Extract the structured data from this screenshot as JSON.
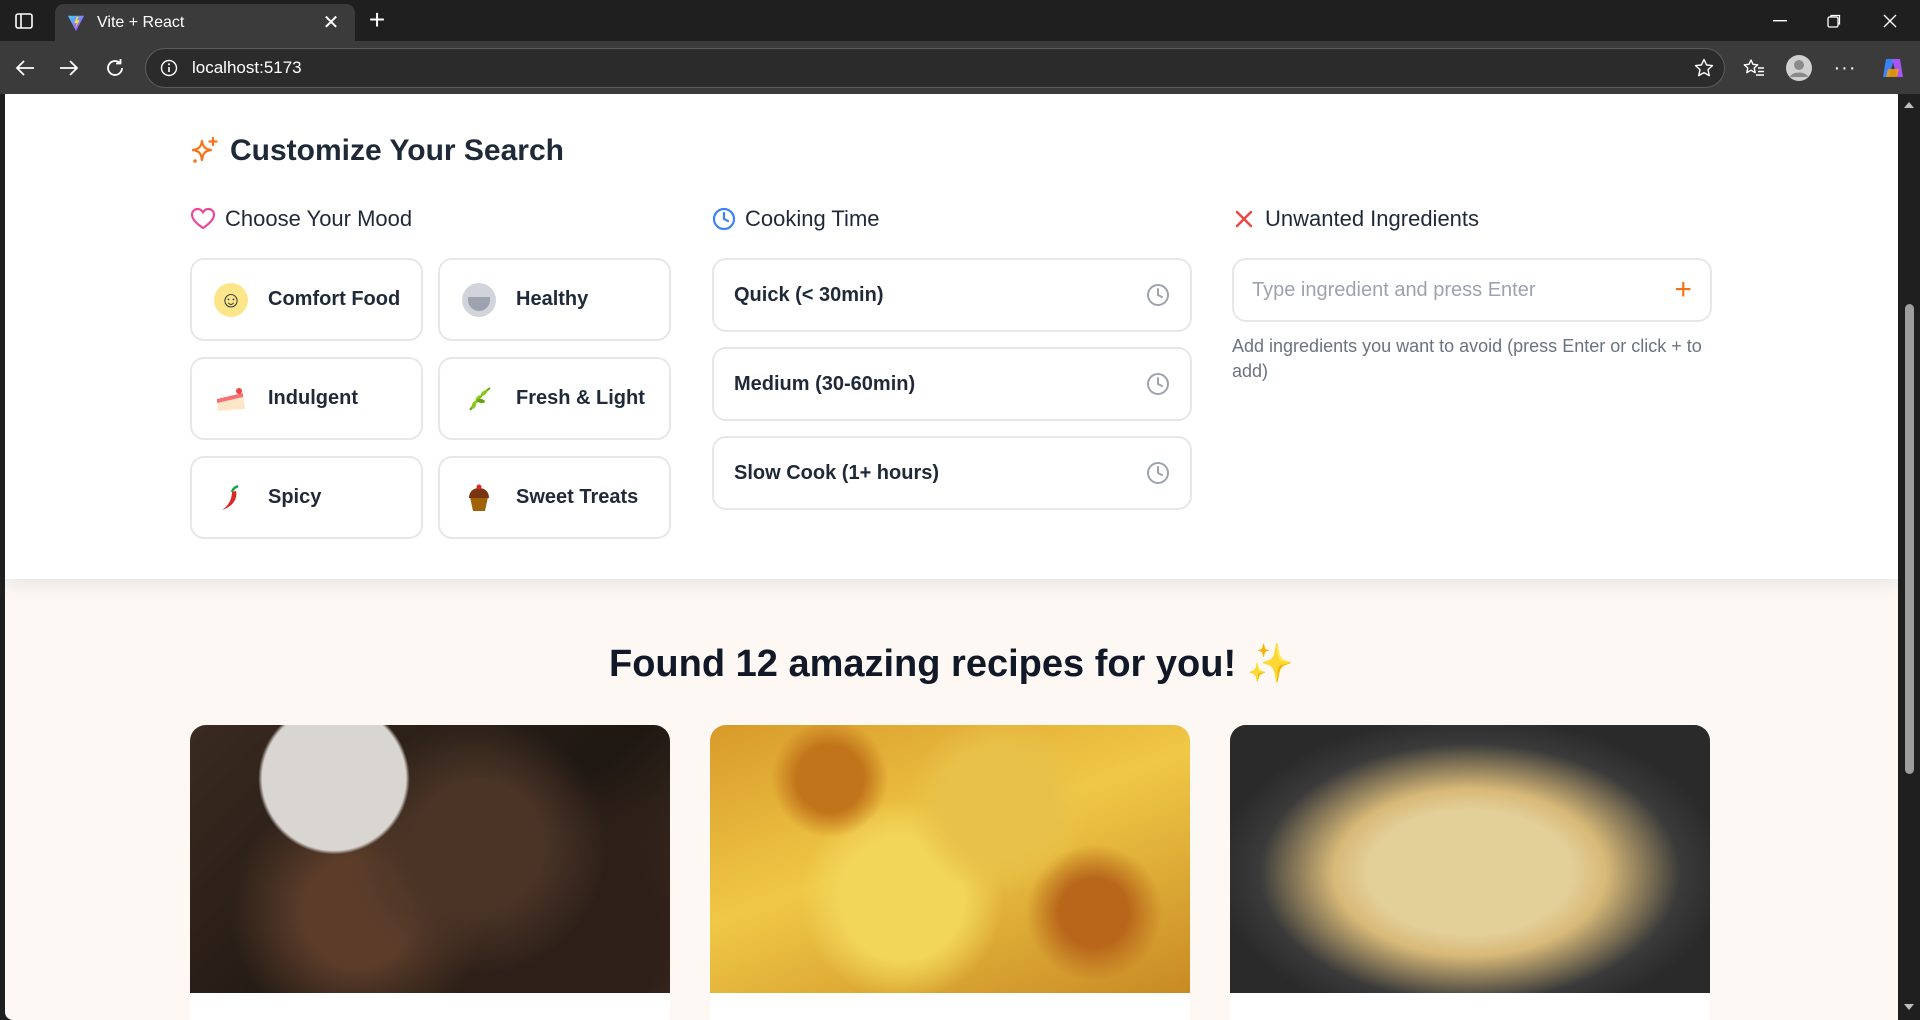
{
  "browser": {
    "tab_title": "Vite + React",
    "url": "localhost:5173"
  },
  "panel": {
    "title": "Customize Your Search",
    "mood": {
      "heading": "Choose Your Mood",
      "options": [
        {
          "label": "Comfort Food",
          "emoji": "🤗"
        },
        {
          "label": "Healthy",
          "emoji": "🥗"
        },
        {
          "label": "Indulgent",
          "emoji": "🍰"
        },
        {
          "label": "Fresh & Light",
          "emoji": "🌿"
        },
        {
          "label": "Spicy",
          "emoji": "🌶"
        },
        {
          "label": "Sweet Treats",
          "emoji": "🧁"
        }
      ]
    },
    "cooking_time": {
      "heading": "Cooking Time",
      "options": [
        {
          "label": "Quick (< 30min)"
        },
        {
          "label": "Medium (30-60min)"
        },
        {
          "label": "Slow Cook (1+ hours)"
        }
      ]
    },
    "ingredients": {
      "heading": "Unwanted Ingredients",
      "placeholder": "Type ingredient and press Enter",
      "add_symbol": "+",
      "help": "Add ingredients you want to avoid (press Enter or click + to add)"
    }
  },
  "results": {
    "heading": "Found 12 amazing recipes for you! ✨"
  },
  "colors": {
    "accent_orange": "#f97316",
    "heart_pink": "#ec4899",
    "clock_blue": "#3b82f6",
    "close_red": "#ef4444"
  }
}
